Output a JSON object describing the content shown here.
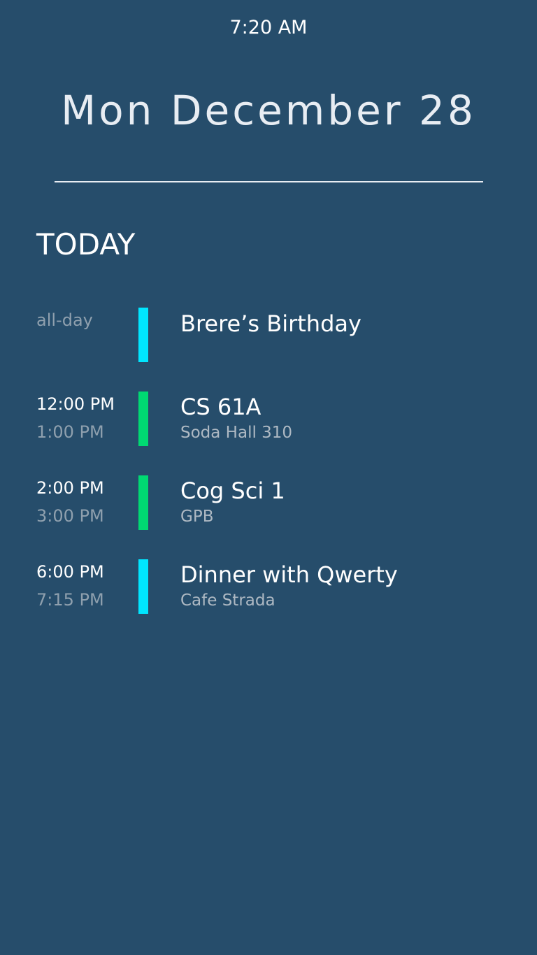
{
  "status": {
    "time": "7:20 AM"
  },
  "header": {
    "date": "Mon December 28"
  },
  "section": {
    "title": "TODAY"
  },
  "colors": {
    "background": "#264d6b",
    "cyan": "#00e6ff",
    "green": "#00d972"
  },
  "events": [
    {
      "start": "all-day",
      "end": "",
      "title": "Brere’s Birthday",
      "location": "",
      "color": "#00e6ff"
    },
    {
      "start": "12:00 PM",
      "end": "1:00 PM",
      "title": "CS 61A",
      "location": "Soda Hall 310",
      "color": "#00d972"
    },
    {
      "start": "2:00 PM",
      "end": "3:00 PM",
      "title": "Cog Sci 1",
      "location": "GPB",
      "color": "#00d972"
    },
    {
      "start": "6:00 PM",
      "end": "7:15 PM",
      "title": "Dinner with Qwerty",
      "location": "Cafe Strada",
      "color": "#00e6ff"
    }
  ]
}
